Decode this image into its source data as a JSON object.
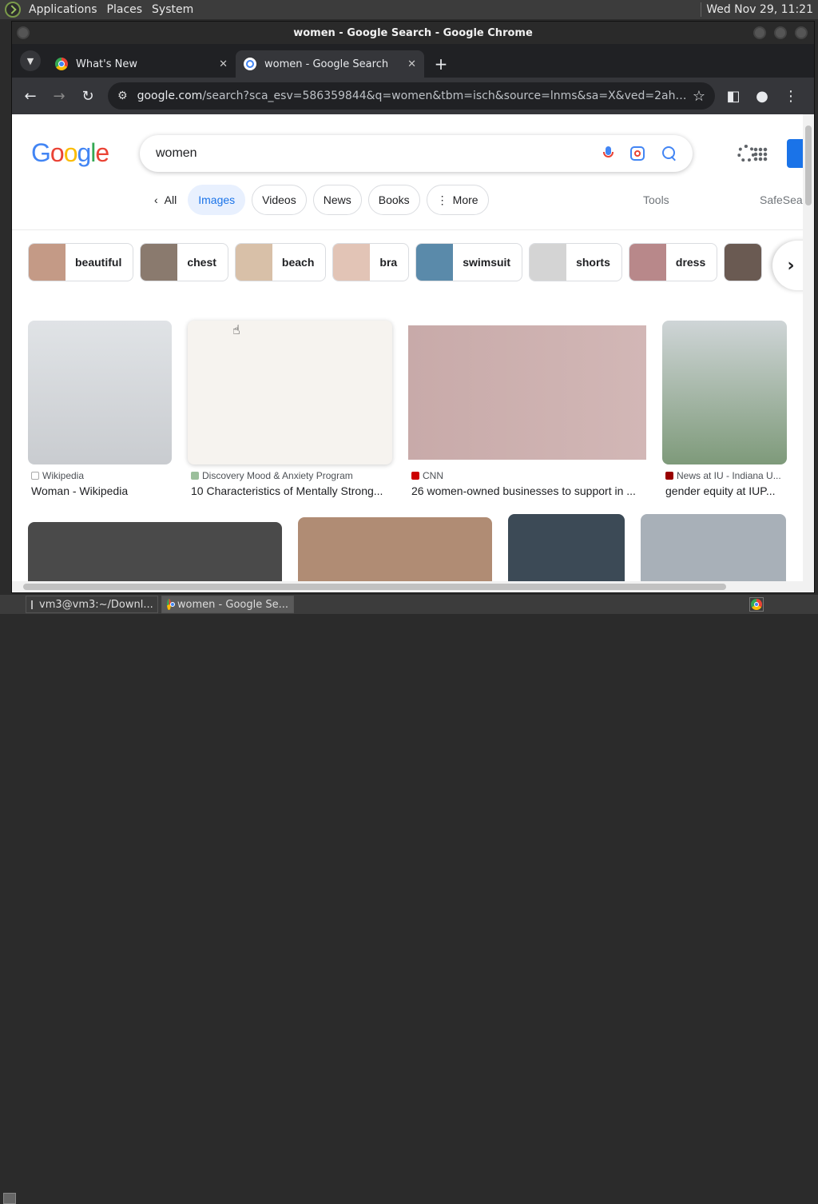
{
  "panel": {
    "menus": [
      "Applications",
      "Places",
      "System"
    ],
    "clock": "Wed Nov 29, 11:21"
  },
  "window": {
    "title": "women - Google Search - Google Chrome"
  },
  "tabs": [
    {
      "title": "What's New",
      "active": false
    },
    {
      "title": "women - Google Search",
      "active": true
    }
  ],
  "toolbar": {
    "url_host": "google.com",
    "url_rest": "/search?sca_esv=586359844&q=women&tbm=isch&source=lnms&sa=X&ved=2ahUKEwiImqPrj-..."
  },
  "google": {
    "logo": [
      "G",
      "o",
      "o",
      "g",
      "l",
      "e"
    ],
    "query": "women",
    "nav": [
      {
        "label": "All",
        "active": false
      },
      {
        "label": "Images",
        "active": true
      },
      {
        "label": "Videos",
        "active": false
      },
      {
        "label": "News",
        "active": false
      },
      {
        "label": "Books",
        "active": false
      },
      {
        "label": "More",
        "active": false
      }
    ],
    "tools": "Tools",
    "safesearch": "SafeSear"
  },
  "refinements": [
    "beautiful",
    "chest",
    "beach",
    "bra",
    "swimsuit",
    "shorts",
    "dress"
  ],
  "results": [
    {
      "source": "Wikipedia",
      "title": "Woman - Wikipedia",
      "color": "#c9ccd0"
    },
    {
      "source": "Discovery Mood & Anxiety Program",
      "title": "10 Characteristics of Mentally Strong...",
      "color": "#f1ede8"
    },
    {
      "source": "CNN",
      "title": "26 women-owned businesses to support in ...",
      "color": "#c9aeae"
    },
    {
      "source": "News at IU - Indiana U...",
      "title": "gender equity at IUP...",
      "color": "#7e9a7a"
    }
  ],
  "row2_colors": [
    "#6c6c6c",
    "#b08c74",
    "#3c4a56",
    "#a8b0b8"
  ],
  "taskbar": {
    "tasks": [
      {
        "label": "vm3@vm3:~/Downl...",
        "active": false
      },
      {
        "label": "women - Google Se...",
        "active": true
      }
    ]
  }
}
